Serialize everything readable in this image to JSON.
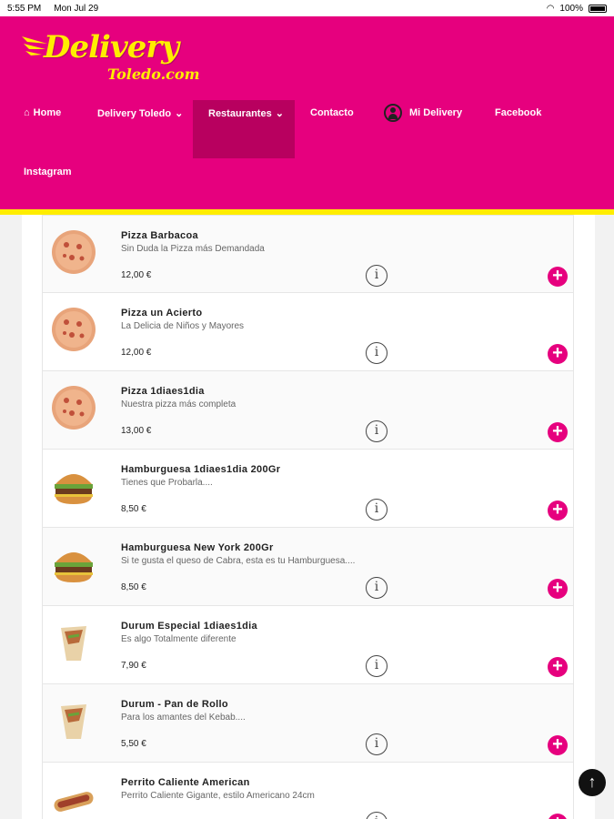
{
  "status_bar": {
    "time": "5:55 PM",
    "date": "Mon Jul 29",
    "battery": "100%"
  },
  "logo": {
    "main": "Delivery",
    "sub": "Toledo.com"
  },
  "nav": {
    "home": "Home",
    "delivery_toledo": "Delivery Toledo",
    "restaurantes": "Restaurantes",
    "contacto": "Contacto",
    "mi_delivery": "Mi Delivery",
    "facebook": "Facebook",
    "instagram": "Instagram"
  },
  "colors": {
    "brand_pink": "#e6007e",
    "brand_yellow": "#ffed00",
    "active_nav": "#b8005f"
  },
  "items": [
    {
      "name": "Pizza Barbacoa",
      "desc": "Sin Duda la Pizza más Demandada",
      "price": "12,00 €",
      "icon": "pizza"
    },
    {
      "name": "Pizza un Acierto",
      "desc": "La Delicia de Niños y Mayores",
      "price": "12,00 €",
      "icon": "pizza"
    },
    {
      "name": "Pizza 1diaes1dia",
      "desc": "Nuestra pizza más completa",
      "price": "13,00 €",
      "icon": "pizza"
    },
    {
      "name": "Hamburguesa 1diaes1dia 200Gr",
      "desc": "Tienes que Probarla....",
      "price": "8,50 €",
      "icon": "burger"
    },
    {
      "name": "Hamburguesa New York 200Gr",
      "desc": "Si te gusta el queso de Cabra, esta es tu Hamburguesa....",
      "price": "8,50 €",
      "icon": "burger"
    },
    {
      "name": "Durum Especial 1diaes1dia",
      "desc": "Es algo Totalmente diferente",
      "price": "7,90 €",
      "icon": "durum"
    },
    {
      "name": "Durum - Pan de Rollo",
      "desc": "Para los amantes del Kebab....",
      "price": "5,50 €",
      "icon": "durum"
    },
    {
      "name": "Perrito Caliente American",
      "desc": "Perrito Caliente Gigante, estilo Americano 24cm",
      "price": "",
      "icon": "hotdog"
    }
  ]
}
